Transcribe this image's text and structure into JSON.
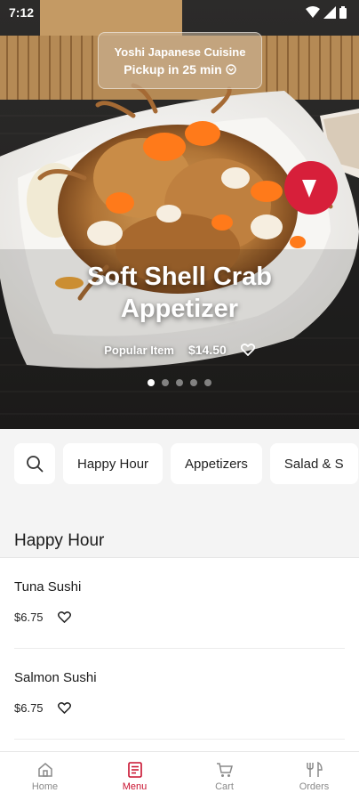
{
  "status_bar": {
    "time": "7:12"
  },
  "hero": {
    "restaurant_name": "Yoshi Japanese Cuisine",
    "pickup_text": "Pickup in 25 min",
    "title_line1": "Soft Shell Crab",
    "title_line2": "Appetizer",
    "badge": "Popular Item",
    "price": "$14.50",
    "carousel_total": 5,
    "carousel_active": 1
  },
  "categories": {
    "search_icon": "search-icon",
    "chips": [
      "Happy Hour",
      "Appetizers",
      "Salad & S"
    ]
  },
  "section": {
    "title": "Happy Hour"
  },
  "items": [
    {
      "name": "Tuna Sushi",
      "price": "$6.75"
    },
    {
      "name": "Salmon Sushi",
      "price": "$6.75"
    }
  ],
  "nav": [
    {
      "label": "Home",
      "icon": "home-icon",
      "active": false
    },
    {
      "label": "Menu",
      "icon": "menu-icon",
      "active": true
    },
    {
      "label": "Cart",
      "icon": "cart-icon",
      "active": false
    },
    {
      "label": "Orders",
      "icon": "orders-icon",
      "active": false
    }
  ],
  "colors": {
    "accent": "#c8102e",
    "inactive": "#8a8a8a",
    "background": "#f4f4f4"
  }
}
